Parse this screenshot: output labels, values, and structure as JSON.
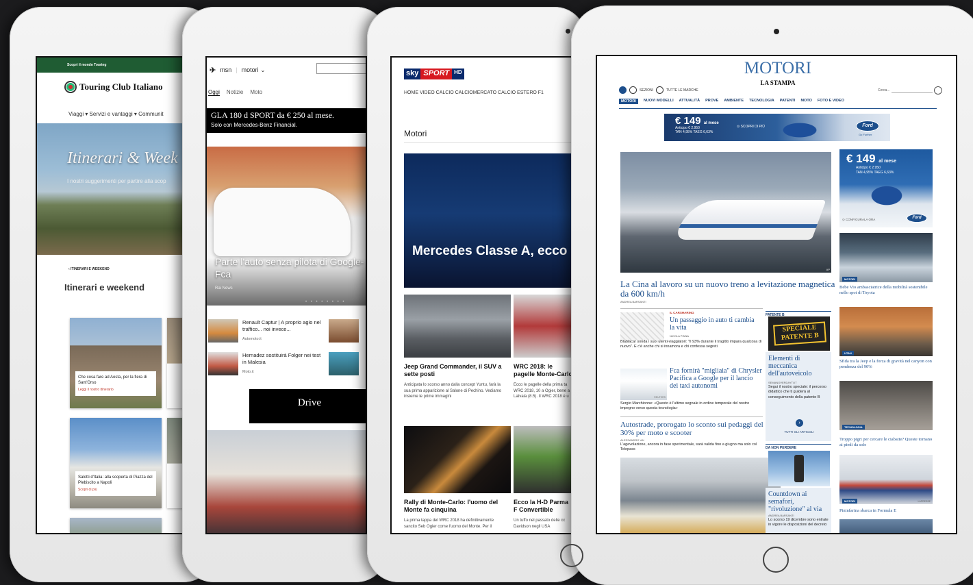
{
  "tablet1": {
    "topbar": "Scopri il mondo Touring",
    "logo": "Touring Club Italiano",
    "nav": "Viaggi ▾   Servizi e vantaggi ▾   Communit",
    "hero_title": "Itinerari & Week",
    "hero_sub": "I nostri suggerimenti per partire alla scop",
    "breadcrumb": "‹ ITINERARI E WEEKEND",
    "section_title": "Itinerari e weekend",
    "cards": [
      {
        "title": "Che cosa fare ad Aosta, per la fiera di Sant'Orso",
        "link": "Leggi il nostro itinerario"
      },
      {
        "title": "Salotti d'Italia: alla scoperta di Piazza del Plebiscito a Napoli",
        "link": "Scopri di più"
      }
    ]
  },
  "tablet2": {
    "brand": "msn",
    "section": "motori ⌄",
    "tabs": [
      "Oggi",
      "Notizie",
      "Moto"
    ],
    "ad_line1": "GLA 180 d SPORT da € 250 al mese.",
    "ad_line2": "Solo con Mercedes-Benz Financial.",
    "hero_caption": "Parte l'auto senza pilota di Google-Fca",
    "hero_source": "Rai News",
    "dots": "• • • • • • • •",
    "items": [
      {
        "title": "Renault Captur | A proprio agio nel traffico... noi invece...",
        "source": "Automoto.it"
      },
      {
        "title": "Hernadez sostituirà Folger nei test in Malesia",
        "source": "Moto.it"
      }
    ],
    "drive": "Drive"
  },
  "tablet3": {
    "logo_a": "sky",
    "logo_b": "SPORT",
    "logo_c": "HD",
    "nav": "HOME    VIDEO    CALCIO    CALCIOMERCATO    CALCIO ESTERO    F1",
    "section": "Motori",
    "hero_title": "Mercedes Classe A, ecco primo teaser",
    "articles": [
      {
        "title": "Jeep Grand Commander, il SUV a sette posti",
        "summary": "Anticipata lo scorso anno dalla concept Yuntu, farà la sua prima apparizione al Salone di Pechino. Vediamo insieme le prime immagini"
      },
      {
        "title": "WRC 2018: le pagelle Monte-Carlo",
        "summary": "Ecco le pagelle della prima ta WRC 2018, 10 a Ogier, bene a Latvala (8.5). Il WRC 2018 è u"
      },
      {
        "title": "Rally di Monte-Carlo: l'uomo del Monte fa cinquina",
        "summary": "La prima tappa del WRC 2018 ha definitivamente sancito Seb Ogier come l'uomo del Monte. Per il"
      },
      {
        "title": "Ecco la H-D Parma F Convertible",
        "summary": "Un tuffo nel passato delle cc Davidson negli USA"
      }
    ]
  },
  "tablet4": {
    "title": "MOTORI",
    "subtitle": "LA STAMPA",
    "sezioni": "SEZIONI",
    "marche": "TUTTE LE MARCHE",
    "search_placeholder": "Cerca...",
    "nav": [
      "MOTORI",
      "NUOVI MODELLI",
      "ATTUALITÀ",
      "PROVE",
      "AMBIENTE",
      "TECNOLOGIA",
      "PATENTI",
      "MOTO",
      "FOTO E VIDEO"
    ],
    "ad_price": "€ 149",
    "ad_per": "al mese",
    "ad_old": "Anticipo € 2.950",
    "ad_tan": "TAN 4,95% TAEG 6,63%",
    "ad_scopri": "SCOPRI DI PIÙ",
    "ad_config": "CONFIGURALA ORA",
    "ford": "Ford",
    "go_further": "Go Further",
    "main_title": "La Cina al lavoro su un nuovo treno a levitazione magnetica da 600 km/h",
    "main_by": "ANDREA BARSANTI",
    "main_credit": "AP",
    "story1_label": "IL CARSHARING",
    "story1_title": "Un passaggio in auto ti cambia la vita",
    "story1_by": "NICOLA PINNA",
    "story1_text": "Blablacar sonda i suoi utenti-viaggiatori: \"Il 93% durante il tragitto impara qualcosa di nuovo\". E c'è anche chi si innamora e chi confessa segreti",
    "story2_title": "Fca fornirà \"migliaia\" di Chrysler Pacifica a Google per il lancio dei taxi autonomi",
    "story2_credit": "REUTERS",
    "story2_text": "Sergio Marchionne: «Questo è l'ultimo segnale in ordine temporale del nostro impegno verso questa tecnologia»",
    "story3_title": "Autostrade, prorogato lo sconto sui pedaggi del 30% per moto e scooter",
    "story3_by": "ALESSANDRO VAI",
    "story3_text": "L'agevolazione, ancora in fase sperimentale, sarà valida fino a giugno ma solo col Telepass",
    "side1_head": "PATENTE B",
    "side1_badge": "SPECIALE PATENTE B",
    "side1_title": "Elementi di meccanica dell'autoveicolo",
    "side1_by": "SEMANOVERDAYTI.IT",
    "side1_text": "Segui il nostro speciale: il percorso didattico che ti guiderà al conseguimento della patente B",
    "side1_all": "TUTTI GLI ARTICOLI",
    "side2_head": "DA NON PERDERE",
    "side2_title": "Countdown ai semafori, \"rivoluzione\" al via",
    "side2_by": "ANDREA BARSANTI",
    "side2_text": "Lo scorso 19 dicembre sono entrate in vigore le disposizioni del decreto",
    "right": [
      {
        "tag": "MOTORI",
        "caption": "Bebe Vio ambasciatrice della mobilità sostenibile nello spot di Toyota"
      },
      {
        "tag": "UTAH",
        "caption": "Sfida tra la Jeep e la forza di gravità nel canyon con pendenza del 90%"
      },
      {
        "tag": "TECNOLOGIA",
        "caption": "Troppo pigri per cercare le ciabatte? Queste tornano ai piedi da sole"
      },
      {
        "tag": "MOTORI",
        "caption": "Pininfarina sbarca in Formula E",
        "credit": "LAPRESSE"
      }
    ]
  }
}
